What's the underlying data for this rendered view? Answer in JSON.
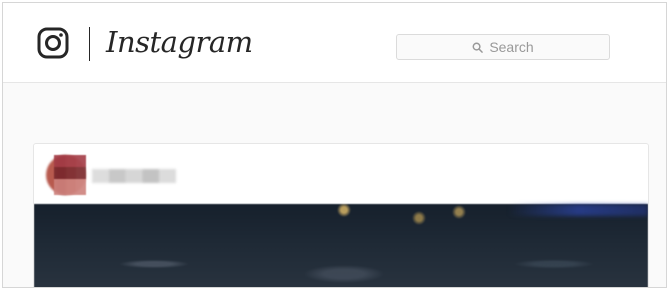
{
  "header": {
    "brand": "Instagram",
    "search": {
      "label": "Search"
    }
  },
  "icons": {
    "camera": "instagram-camera-icon",
    "search": "search-icon"
  },
  "colors": {
    "text_dark": "#262626",
    "placeholder": "#999999",
    "border": "#dbdbdb",
    "page_bg": "#fafafa"
  }
}
